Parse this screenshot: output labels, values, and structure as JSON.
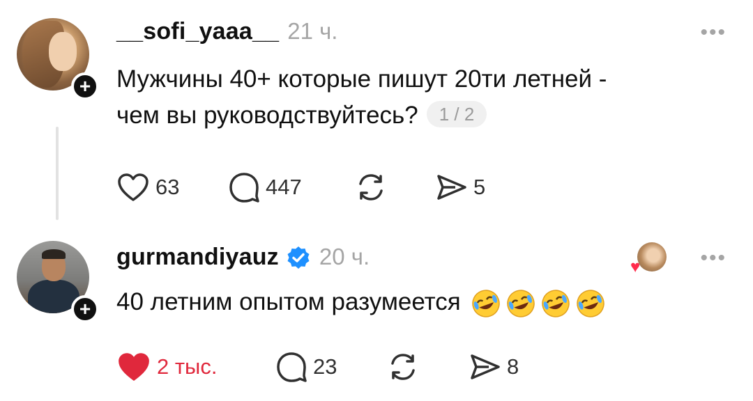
{
  "posts": [
    {
      "username": "__sofi_yaaa__",
      "time": "21 ч.",
      "text_lines": [
        "Мужчины 40+ которые пишут 20ти летней -",
        "чем вы руководствуйтесь?"
      ],
      "page_indicator": "1 / 2",
      "more_icon": "ellipsis-icon",
      "likes": "63",
      "comments": "447",
      "shares": "5",
      "liked": false
    },
    {
      "username": "gurmandiyauz",
      "verified": true,
      "time": "20 ч.",
      "text": "40 летним опытом разумеется",
      "emoji_count": 4,
      "emoji": "rolling-on-floor-laughing",
      "more_icon": "ellipsis-icon",
      "likes": "2 тыс.",
      "comments": "23",
      "shares": "8",
      "liked": true
    }
  ],
  "colors": {
    "text": "#101010",
    "muted": "#a5a5a5",
    "like_red": "#e0283c",
    "verified_blue": "#1e90ff",
    "thread_line": "#e2e2e2"
  }
}
